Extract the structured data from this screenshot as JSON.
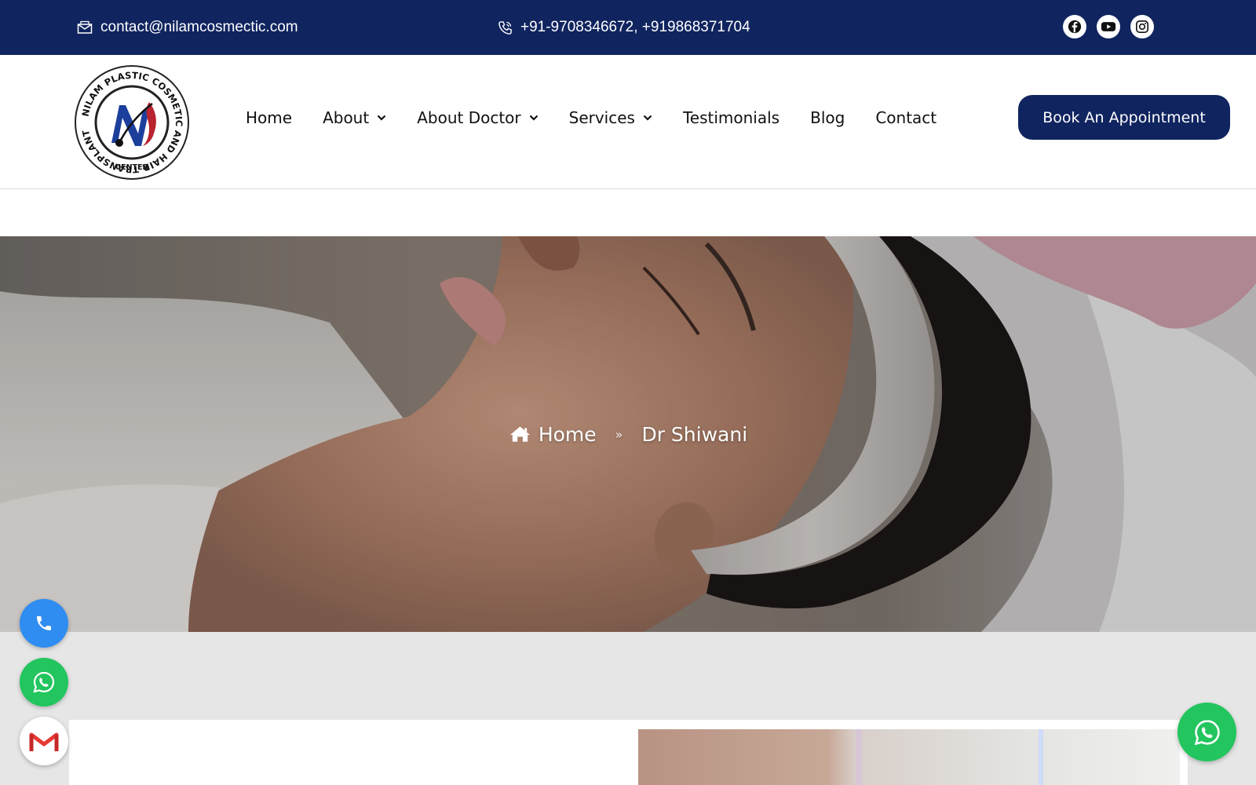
{
  "topbar": {
    "email": "contact@nilamcosmectic.com",
    "phones": "+91-9708346672, +919868371704",
    "socials": [
      {
        "icon": "facebook-icon"
      },
      {
        "icon": "youtube-icon"
      },
      {
        "icon": "instagram-icon"
      }
    ]
  },
  "logo": {
    "ring_text": "NILAM PLASTIC COSMETIC AND HAIR TRANSPLANT",
    "center_text": "CENTER"
  },
  "nav": {
    "items": [
      {
        "label": "Home",
        "dropdown": false
      },
      {
        "label": "About",
        "dropdown": true
      },
      {
        "label": "About Doctor",
        "dropdown": true
      },
      {
        "label": "Services",
        "dropdown": true
      },
      {
        "label": "Testimonials",
        "dropdown": false
      },
      {
        "label": "Blog",
        "dropdown": false
      },
      {
        "label": "Contact",
        "dropdown": false
      }
    ],
    "cta": "Book An Appointment"
  },
  "breadcrumb": {
    "home": "Home",
    "separator": "»",
    "current": "Dr Shiwani"
  },
  "colors": {
    "navy": "#10245f",
    "call": "#2f8df1",
    "whatsapp": "#22c55e",
    "lower_bg": "#e6e6e6"
  }
}
